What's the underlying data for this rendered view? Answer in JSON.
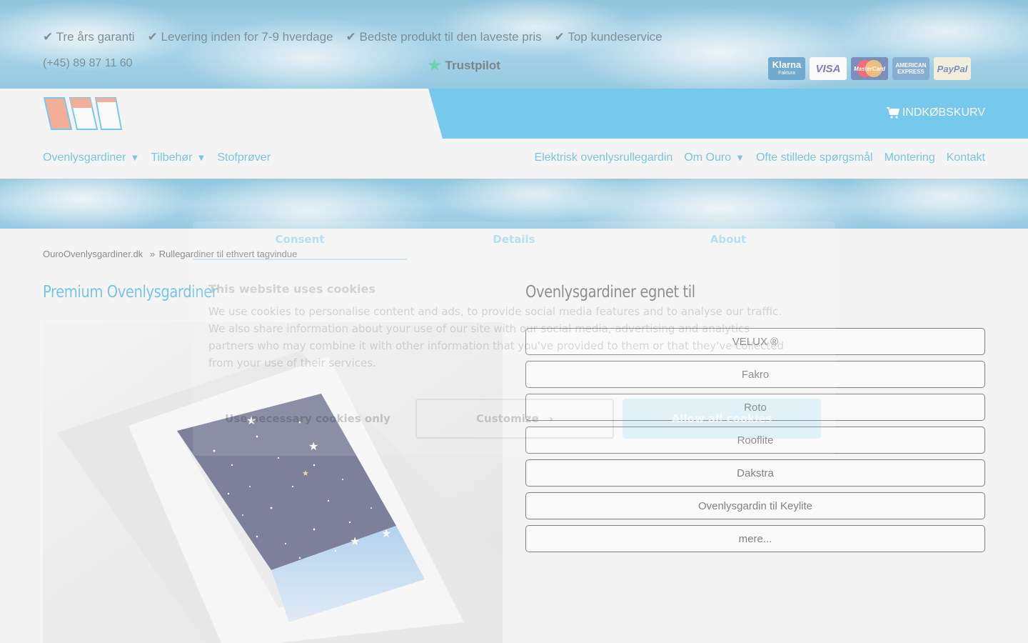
{
  "topbar": {
    "usps": [
      "✔ Tre års garanti",
      "✔ Levering inden for 7-9 hverdage",
      "✔ Bedste produkt til den laveste pris",
      "✔ Top kundeservice"
    ],
    "phone": "(+45) 89 87 11 60",
    "trustpilot": "Trustpilot",
    "payments": {
      "klarna": "Klarna",
      "klarna_sub": "Faktura",
      "visa": "VISA",
      "mastercard": "MasterCard",
      "amex_line1": "AMERICAN",
      "amex_line2": "EXPRESS",
      "paypal": "PayPal"
    }
  },
  "header": {
    "cart_label": "INDKØBSKURV",
    "nav_left": [
      {
        "label": "Ovenlysgardiner",
        "dropdown": true
      },
      {
        "label": "Tilbehør",
        "dropdown": true
      },
      {
        "label": "Stofprøver",
        "dropdown": false
      }
    ],
    "nav_right": [
      {
        "label": "Elektrisk ovenlysrullegardin",
        "dropdown": false
      },
      {
        "label": "Om Ouro",
        "dropdown": true
      },
      {
        "label": "Ofte stillede spørgsmål",
        "dropdown": false
      },
      {
        "label": "Montering",
        "dropdown": false
      },
      {
        "label": "Kontakt",
        "dropdown": false
      }
    ],
    "caret": "▼"
  },
  "breadcrumb": {
    "home": "OuroOvenlysgardiner.dk",
    "separator": "»",
    "current": "Rullegardiner til ethvert tagvindue"
  },
  "main": {
    "title": "Premium Ovenlysgardiner",
    "subtitle": "Ovenlysgardiner egnet til",
    "brands": [
      "VELUX ®",
      "Fakro",
      "Roto",
      "Rooflite",
      "Dakstra",
      "Ovenlysgardin til Keylite",
      "mere..."
    ]
  },
  "cookie": {
    "tabs": [
      "Consent",
      "Details",
      "About"
    ],
    "heading": "This website uses cookies",
    "text": "We use cookies to personalise content and ads, to provide social media features and to analyse our traffic. We also share information about your use of our site with our social media, advertising and analytics partners who may combine it with other information that you've provided to them or that they've collected from your use of their services.",
    "btn_necessary": "Use necessary cookies only",
    "btn_customize": "Customize",
    "btn_customize_arrow": "›",
    "btn_allow": "Allow all cookies"
  },
  "colors": {
    "brand_blue": "#12a6e3",
    "logo_orange": "#f2764f"
  }
}
